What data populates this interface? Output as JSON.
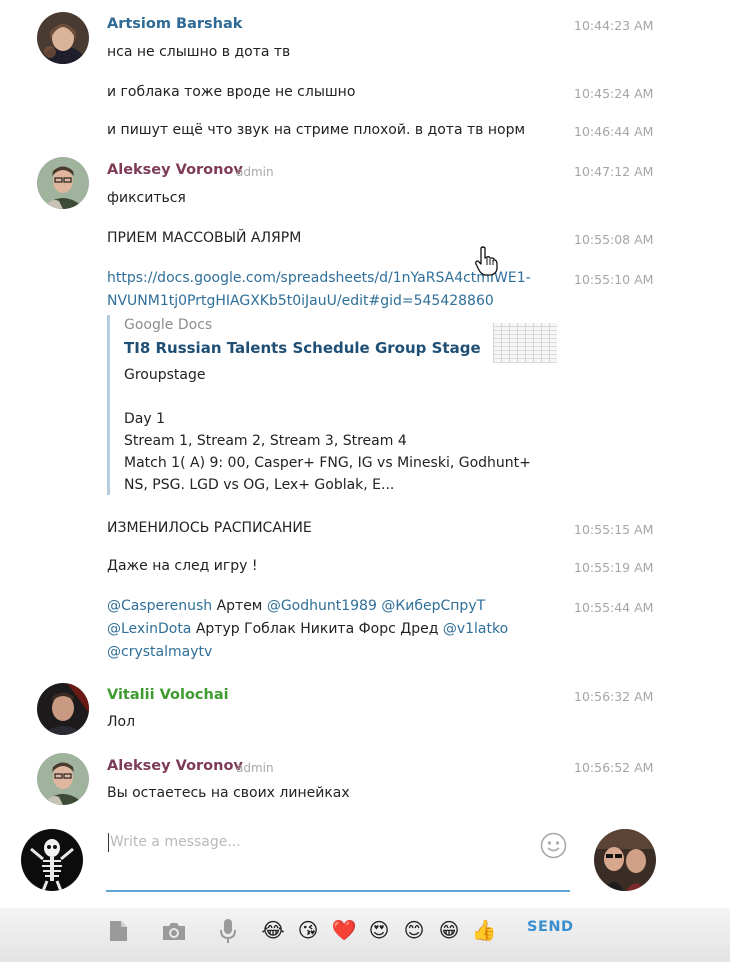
{
  "colors": {
    "artsiom": "#2f6a96",
    "aleksey": "#7e3b57",
    "vitalii": "#3e9b2f",
    "link": "#2f6f99",
    "send": "#3a8fd0"
  },
  "messages": {
    "artsiom_name": "Artsiom Barshak",
    "m1": {
      "text": "нса не слышно в дота тв",
      "time": "10:44:23 AM"
    },
    "m2": {
      "text": "и гоблака тоже вроде не слышно",
      "time": "10:45:24 AM"
    },
    "m3": {
      "text": "и пишут ещё что звук на стриме плохой. в дота тв норм",
      "time": "10:46:44 AM"
    },
    "aleksey_name": "Aleksey Voronov",
    "admin_label": "admin",
    "m4": {
      "text": "фикситься",
      "time": "10:47:12 AM"
    },
    "m5": {
      "text": "ПРИЕМ МАССОВЫЙ АЛЯРМ",
      "time": "10:55:08 AM"
    },
    "m6": {
      "link_line1": "https://docs.google.com/spreadsheets/d/1nYaRSA4ctmIWE1-",
      "link_line2": "NVUNM1tj0PrtgHIAGXKb5t0iJauU/edit#gid=545428860",
      "time": "10:55:10 AM"
    },
    "preview": {
      "site": "Google Docs",
      "title": "TI8 Russian Talents Schedule Group Stage",
      "description": "Groupstage\n\nDay 1\nStream 1, Stream 2, Stream 3, Stream 4\nMatch 1( A) 9: 00, Casper+ FNG, IG vs Mineski, Godhunt+\nNS, PSG. LGD vs OG, Lex+ Goblak, E..."
    },
    "m7": {
      "text": "ИЗМЕНИЛОСЬ РАСПИСАНИЕ",
      "time": "10:55:15 AM"
    },
    "m8": {
      "text": "Даже на след игру !",
      "time": "10:55:19 AM"
    },
    "m9": {
      "mention1": "@Casperenush",
      "t1": " Артем ",
      "mention2": "@Godhunt1989",
      "t2": " ",
      "mention3": "@КиберСпруТ",
      "mention4": "@LexinDota",
      "t3": " Артур Гоблак Никита Форс Дред ",
      "mention5": "@v1latko",
      "mention6": "@crystalmaytv",
      "time": "10:55:44 AM"
    },
    "vitalii_name": "Vitalii Volochai",
    "m10": {
      "text": "Лол",
      "time": "10:56:32 AM"
    },
    "aleksey_name2": "Aleksey Voronov",
    "admin_label2": "admin",
    "m11": {
      "text": "Вы остаетесь на своих линейках",
      "time": "10:56:52 AM"
    }
  },
  "composer": {
    "placeholder": "Write a message...",
    "emoji_icon": "smiley-icon"
  },
  "toolbar": {
    "icons": [
      "file-icon",
      "camera-icon",
      "microphone-icon"
    ],
    "emojis": [
      "😂",
      "😘",
      "❤️",
      "😍",
      "😊",
      "😁",
      "👍"
    ],
    "send_label": "SEND"
  }
}
